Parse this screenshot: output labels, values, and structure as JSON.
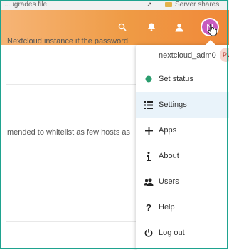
{
  "browser_strip": {
    "left_text": "...ugrades file",
    "right_text": "Server shares"
  },
  "header": {
    "avatar_initial": "N",
    "brand_color": "#f08839"
  },
  "content": {
    "line1": "Nextcloud instance if the password",
    "line2": "mended to whitelist as few hosts as"
  },
  "menu": {
    "user": {
      "name": "nextcloud_adm0",
      "tag": "PW"
    },
    "items": [
      {
        "label": "Set status",
        "icon": "status-dot-icon"
      },
      {
        "label": "Settings",
        "icon": "settings-list-icon",
        "active": true
      },
      {
        "label": "Apps",
        "icon": "plus-icon"
      },
      {
        "label": "About",
        "icon": "info-icon"
      },
      {
        "label": "Users",
        "icon": "users-icon"
      },
      {
        "label": "Help",
        "icon": "help-icon"
      },
      {
        "label": "Log out",
        "icon": "power-icon"
      }
    ]
  },
  "colors": {
    "status_online": "#2a9d6e",
    "frame_border": "#1fa38f",
    "active_row": "#e9f3fa"
  }
}
